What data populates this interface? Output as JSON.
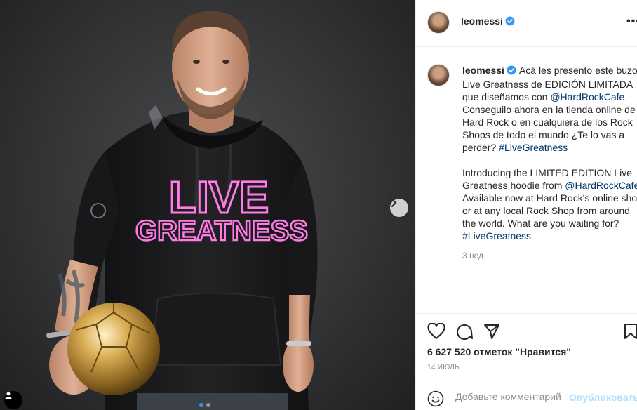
{
  "post": {
    "username": "leomessi",
    "verified": true,
    "caption_es": "Acá les presento este buzo Live Greatness de EDICIÓN LIMITADA que diseñamos con ",
    "mention_1": "@HardRockCafe",
    "caption_es_2": ". Conseguilo ahora en la tienda online de Hard Rock o en cualquiera de los Rock Shops de todo el mundo ¿Te lo vas a perder? ",
    "hashtag_1": "#LiveGreatness",
    "caption_en": "\n\nIntroducing the LIMITED EDITION Live Greatness hoodie from ",
    "mention_2": "@HardRockCafe",
    "caption_en_2": ". Available now at Hard Rock's online shop or at any local Rock Shop from around the world. What are you waiting for? ",
    "hashtag_2": "#LiveGreatness",
    "time_ago": "3 нед.",
    "likes": "6 627 520 отметок \"Нравится\"",
    "date": "14 ИЮЛЬ"
  },
  "photo": {
    "hoodie_text_line1": "LIVE",
    "hoodie_text_line2": "GREATNESS",
    "carousel_count": 2,
    "carousel_active": 0
  },
  "comment": {
    "placeholder": "Добавьте комментарий...",
    "post_label": "Опубликовать"
  },
  "colors": {
    "verified_blue": "#3897f0",
    "link_blue": "#00376b",
    "neon_pink": "#ff7be6",
    "post_button_disabled": "#b2dffc"
  },
  "icons": [
    "chevron-right-icon",
    "user-tag-icon",
    "verified-icon",
    "more-icon",
    "heart-icon",
    "comment-icon",
    "share-icon",
    "bookmark-icon",
    "emoji-icon"
  ]
}
